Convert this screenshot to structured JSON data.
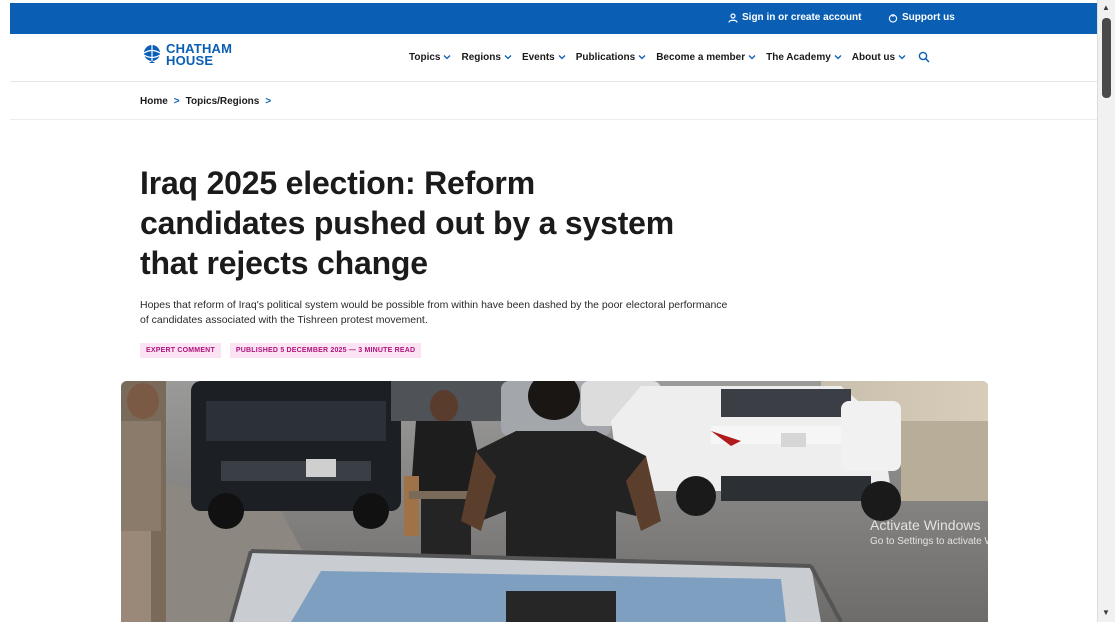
{
  "topbar": {
    "signin_label": "Sign in or create account",
    "support_label": "Support us",
    "background": "#0a5fb4"
  },
  "logo": {
    "line1": "CHATHAM",
    "line2": "HOUSE"
  },
  "nav": {
    "items": [
      {
        "label": "Topics"
      },
      {
        "label": "Regions"
      },
      {
        "label": "Events"
      },
      {
        "label": "Publications"
      },
      {
        "label": "Become a member"
      },
      {
        "label": "The Academy"
      },
      {
        "label": "About us"
      }
    ],
    "search_icon": "search-icon"
  },
  "breadcrumb": {
    "items": [
      "Home",
      "Topics/Regions"
    ],
    "separator": ">"
  },
  "article": {
    "title": "Iraq 2025 election: Reform candidates pushed out by a system that rejects change",
    "summary": "Hopes that reform of Iraq's political system would be possible from within have been dashed by the poor electoral performance of candidates associated with the Tishreen protest movement.",
    "tags": [
      "EXPERT COMMENT",
      "PUBLISHED 5 DECEMBER 2025 — 3 MINUTE READ"
    ],
    "tag_color": "#b0127d",
    "tag_background": "#fbe3f3"
  },
  "watermark": {
    "line1": "Activate Windows",
    "line2": "Go to Settings to activate Windows."
  },
  "colors": {
    "accent": "#0a5fb4"
  }
}
